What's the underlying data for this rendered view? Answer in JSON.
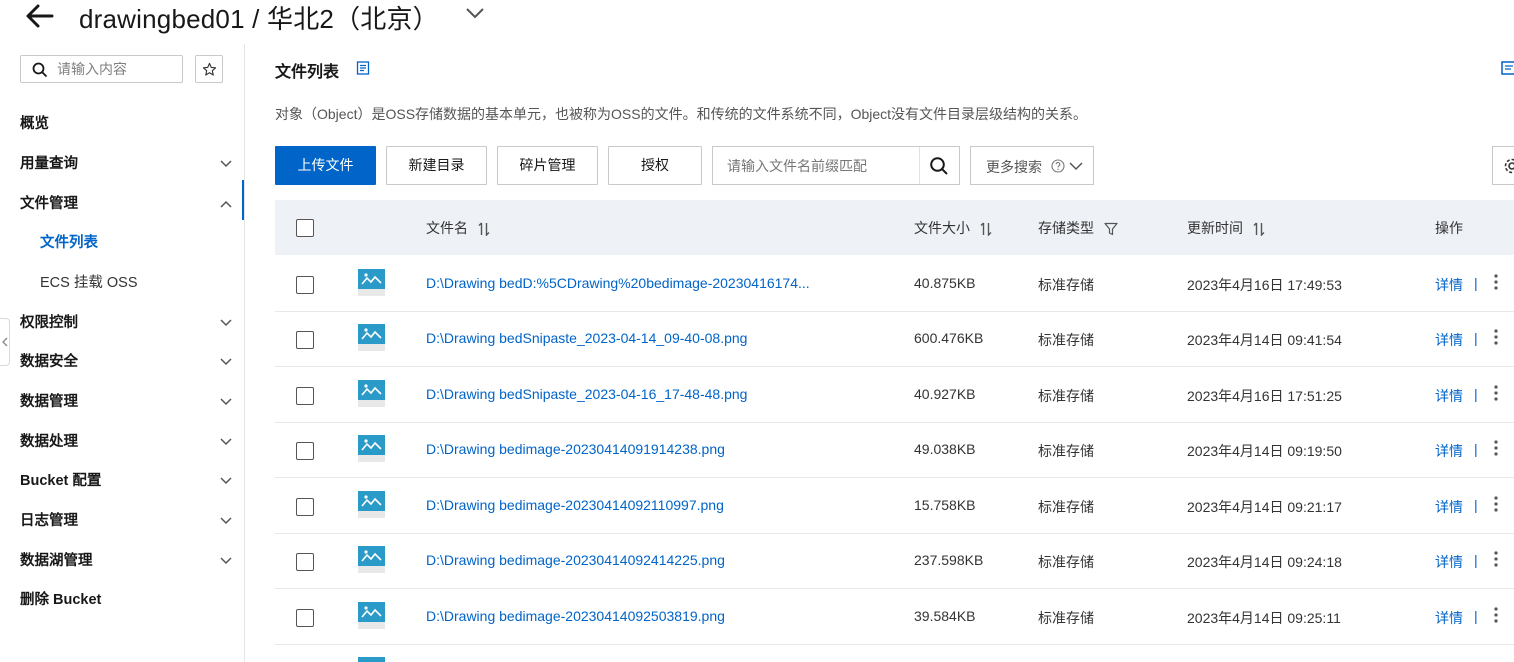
{
  "header": {
    "title": "drawingbed01 / 华北2（北京）"
  },
  "sidebar": {
    "search_placeholder": "请输入内容",
    "items": [
      {
        "label": "概览",
        "expandable": false
      },
      {
        "label": "用量查询",
        "expandable": true,
        "state": "collapsed"
      },
      {
        "label": "文件管理",
        "expandable": true,
        "state": "expanded"
      },
      {
        "label": "权限控制",
        "expandable": true,
        "state": "collapsed"
      },
      {
        "label": "数据安全",
        "expandable": true,
        "state": "collapsed"
      },
      {
        "label": "数据管理",
        "expandable": true,
        "state": "collapsed"
      },
      {
        "label": "数据处理",
        "expandable": true,
        "state": "collapsed"
      },
      {
        "label": "Bucket 配置",
        "expandable": true,
        "state": "collapsed"
      },
      {
        "label": "日志管理",
        "expandable": true,
        "state": "collapsed"
      },
      {
        "label": "数据湖管理",
        "expandable": true,
        "state": "collapsed"
      },
      {
        "label": "删除 Bucket",
        "expandable": false
      }
    ],
    "sub_items": [
      {
        "label": "文件列表",
        "active": true
      },
      {
        "label": "ECS 挂载 OSS",
        "active": false
      }
    ]
  },
  "main": {
    "title": "文件列表",
    "description": "对象（Object）是OSS存储数据的基本单元，也被称为OSS的文件。和传统的文件系统不同，Object没有文件目录层级结构的关系。",
    "toolbar": {
      "upload_label": "上传文件",
      "new_dir_label": "新建目录",
      "fragment_label": "碎片管理",
      "authorize_label": "授权",
      "search_placeholder": "请输入文件名前缀匹配",
      "more_search_label": "更多搜索"
    },
    "table": {
      "columns": [
        "文件名",
        "文件大小",
        "存储类型",
        "更新时间",
        "操作"
      ],
      "rows": [
        {
          "name": "D:\\Drawing bedD:%5CDrawing%20bedimage-20230416174...",
          "size": "40.875KB",
          "storage": "标准存储",
          "updated": "2023年4月16日 17:49:53",
          "action": "详情"
        },
        {
          "name": "D:\\Drawing bedSnipaste_2023-04-14_09-40-08.png",
          "size": "600.476KB",
          "storage": "标准存储",
          "updated": "2023年4月14日 09:41:54",
          "action": "详情"
        },
        {
          "name": "D:\\Drawing bedSnipaste_2023-04-16_17-48-48.png",
          "size": "40.927KB",
          "storage": "标准存储",
          "updated": "2023年4月16日 17:51:25",
          "action": "详情"
        },
        {
          "name": "D:\\Drawing bedimage-20230414091914238.png",
          "size": "49.038KB",
          "storage": "标准存储",
          "updated": "2023年4月14日 09:19:50",
          "action": "详情"
        },
        {
          "name": "D:\\Drawing bedimage-20230414092110997.png",
          "size": "15.758KB",
          "storage": "标准存储",
          "updated": "2023年4月14日 09:21:17",
          "action": "详情"
        },
        {
          "name": "D:\\Drawing bedimage-20230414092414225.png",
          "size": "237.598KB",
          "storage": "标准存储",
          "updated": "2023年4月14日 09:24:18",
          "action": "详情"
        },
        {
          "name": "D:\\Drawing bedimage-20230414092503819.png",
          "size": "39.584KB",
          "storage": "标准存储",
          "updated": "2023年4月14日 09:25:11",
          "action": "详情"
        }
      ],
      "action_separator": "|"
    }
  },
  "colors": {
    "accent": "#0064c8",
    "header_bg": "#eef2f6",
    "thumb": "#2a9bc9"
  },
  "icons": [
    "back-arrow-icon",
    "chevron-down-icon",
    "search-icon",
    "star-icon",
    "doc-icon",
    "question-icon",
    "gear-icon",
    "sort-icon",
    "filter-icon",
    "image-thumbnail-icon",
    "more-vertical-icon"
  ]
}
